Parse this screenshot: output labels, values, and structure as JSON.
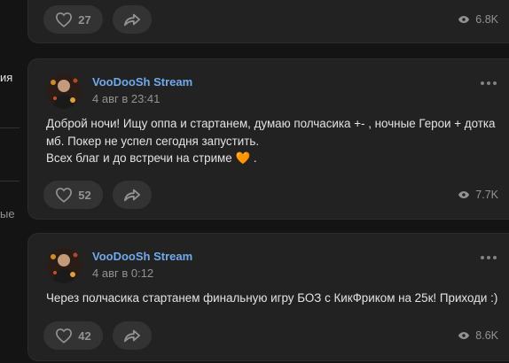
{
  "sidebar": {
    "item_1": "ия",
    "item_2": "ые"
  },
  "posts": [
    {
      "likes": "27",
      "views": "6.8K"
    },
    {
      "author": "VooDooSh Stream",
      "date": "4 авг в 23:41",
      "line_1": "Доброй ночи! Ищу оппа и стартанем, думаю полчасика +- , ночные Герои + дотка",
      "line_2": "мб. Покер не успел сегодня запустить.",
      "line_3": "Всех благ и до встречи на стриме",
      "line_3_tail": ".",
      "emoji": "🧡",
      "likes": "52",
      "views": "7.7K"
    },
    {
      "author": "VooDooSh Stream",
      "date": "4 авг в 0:12",
      "line_1": "Через полчасика стартанем финальную игру БОЗ с КикФриком на 25к! Приходи :)",
      "likes": "42",
      "views": "8.6K"
    }
  ],
  "icons": {
    "like": "heart-outline-icon",
    "share": "share-arrow-icon",
    "views": "eye-icon",
    "more": "more-dots-icon"
  }
}
